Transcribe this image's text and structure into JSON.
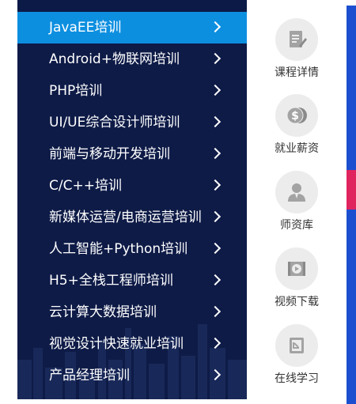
{
  "menu": {
    "items": [
      {
        "label": "JavaEE培训",
        "active": true
      },
      {
        "label": "Android+物联网培训",
        "active": false
      },
      {
        "label": "PHP培训",
        "active": false
      },
      {
        "label": "UI/UE综合设计师培训",
        "active": false
      },
      {
        "label": "前端与移动开发培训",
        "active": false
      },
      {
        "label": "C/C++培训",
        "active": false
      },
      {
        "label": "新媒体运营/电商运营培训",
        "active": false
      },
      {
        "label": "人工智能+Python培训",
        "active": false
      },
      {
        "label": "H5+全栈工程师培训",
        "active": false
      },
      {
        "label": "云计算大数据培训",
        "active": false
      },
      {
        "label": "视觉设计快速就业培训",
        "active": false
      },
      {
        "label": "产品经理培训",
        "active": false
      }
    ],
    "chevron_icon": "chevron-right-icon"
  },
  "sidebar": {
    "items": [
      {
        "label": "课程详情",
        "icon": "course-detail-icon"
      },
      {
        "label": "就业薪资",
        "icon": "salary-coins-icon"
      },
      {
        "label": "师资库",
        "icon": "teacher-icon"
      },
      {
        "label": "视频下载",
        "icon": "video-download-icon"
      },
      {
        "label": "在线学习",
        "icon": "online-learning-icon"
      }
    ]
  },
  "colors": {
    "menu_bg": "#0e1b47",
    "active_bg": "#0d8fe0",
    "icon_circle": "#ececec",
    "icon_fg": "#a3a3a3"
  }
}
